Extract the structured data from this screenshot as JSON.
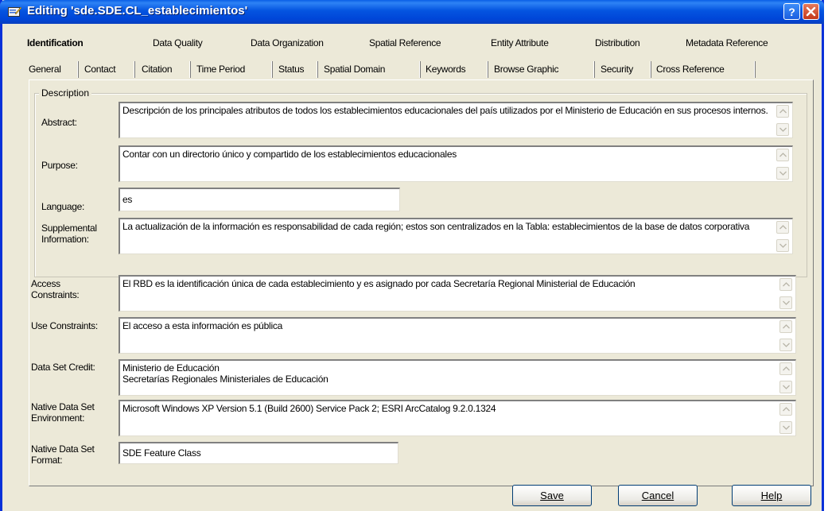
{
  "window": {
    "title": "Editing 'sde.SDE.CL_establecimientos'"
  },
  "top_tabs": [
    {
      "label": "Identification",
      "selected": true
    },
    {
      "label": "Data Quality"
    },
    {
      "label": "Data Organization"
    },
    {
      "label": "Spatial Reference"
    },
    {
      "label": "Entity Attribute"
    },
    {
      "label": "Distribution"
    },
    {
      "label": "Metadata Reference"
    }
  ],
  "sub_tabs": [
    {
      "label": "General",
      "selected": true
    },
    {
      "label": "Contact"
    },
    {
      "label": "Citation"
    },
    {
      "label": "Time Period"
    },
    {
      "label": "Status"
    },
    {
      "label": "Spatial Domain"
    },
    {
      "label": "Keywords"
    },
    {
      "label": "Browse Graphic"
    },
    {
      "label": "Security"
    },
    {
      "label": "Cross Reference"
    }
  ],
  "description": {
    "legend": "Description",
    "abstract_label": "Abstract:",
    "abstract_value": "Descripción de los principales atributos de todos los establecimientos educacionales del país utilizados por el Ministerio de Educación en sus procesos internos.",
    "purpose_label": "Purpose:",
    "purpose_value": "Contar con un directorio único y compartido de los establecimientos educacionales",
    "language_label": "Language:",
    "language_value": "es",
    "supplemental_label": "Supplemental Information:",
    "supplemental_value": "La actualización de la información es responsabilidad de cada región; estos son centralizados en la Tabla: establecimientos de la base de datos corporativa"
  },
  "fields": {
    "access_label": "Access Constraints:",
    "access_value": "El RBD es la identificación única de cada establecimiento y es asignado por cada Secretaría Regional Ministerial de Educación",
    "use_label": "Use Constraints:",
    "use_value": "El acceso a esta información es pública",
    "credit_label": "Data Set Credit:",
    "credit_value": "Ministerio de Educación\nSecretarías Regionales Ministeriales de Educación",
    "env_label": "Native Data Set Environment:",
    "env_value": "Microsoft Windows XP Version 5.1 (Build 2600) Service Pack 2; ESRI ArcCatalog 9.2.0.1324",
    "format_label": "Native Data Set Format:",
    "format_value": "SDE Feature Class"
  },
  "buttons": {
    "save": "Save",
    "cancel": "Cancel",
    "help": "Help"
  }
}
